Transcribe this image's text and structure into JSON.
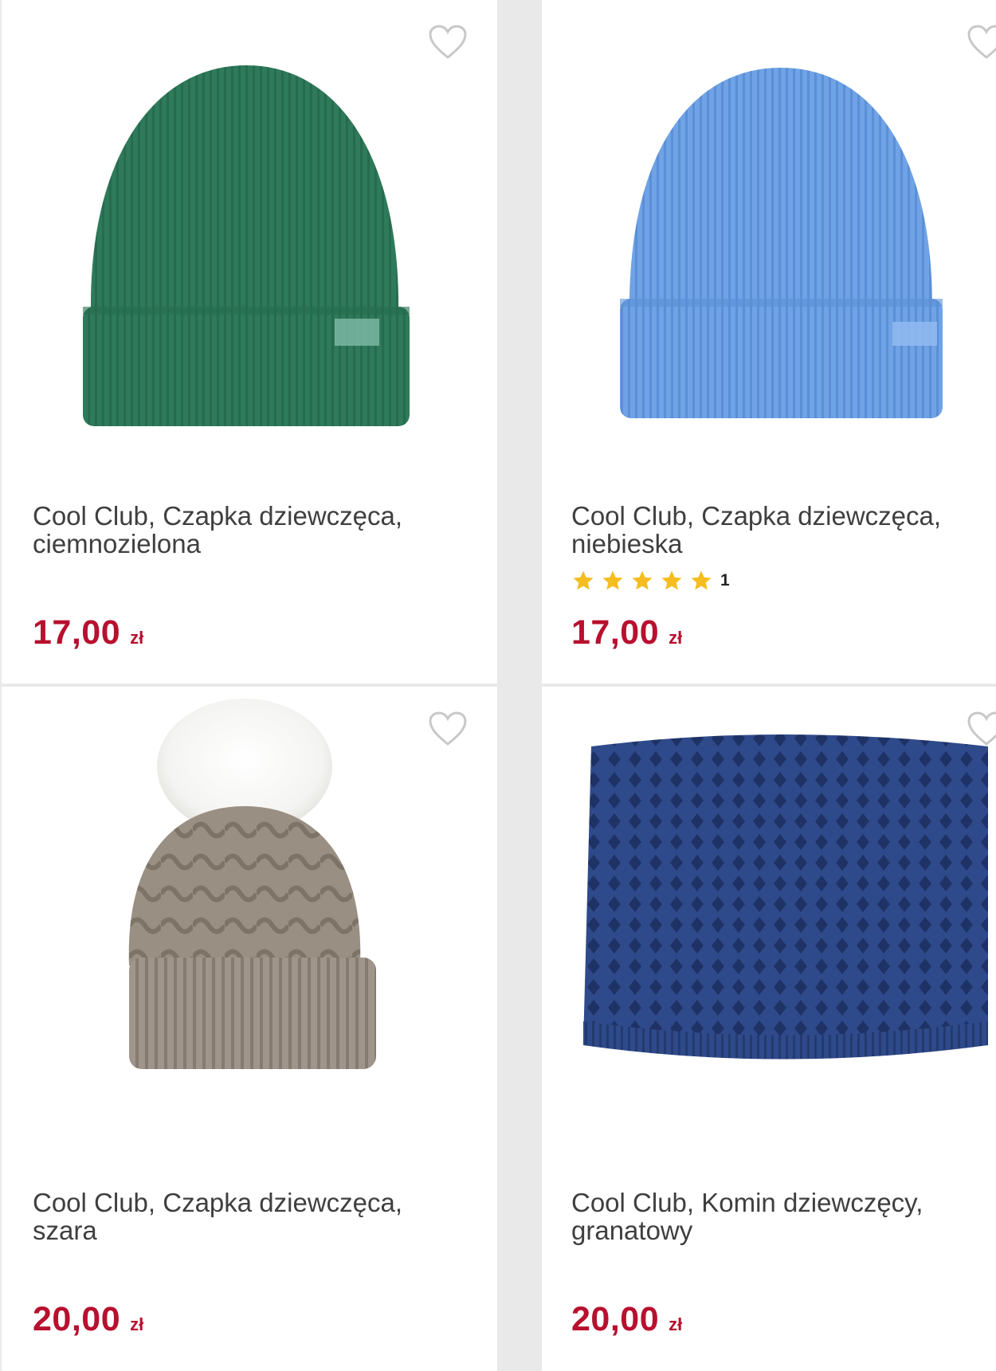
{
  "products": [
    {
      "title": "Cool Club, Czapka dziewczęca,\nciemnozielona",
      "price": "17,00",
      "currency": "zł",
      "rating_count": "",
      "color": "#2e7a5a",
      "image_icon": "green-beanie"
    },
    {
      "title": "Cool Club, Czapka dziewczęca,\nniebieska",
      "price": "17,00",
      "currency": "zł",
      "rating_stars": 5,
      "rating_count": "1",
      "color": "#6fa3e6",
      "image_icon": "blue-beanie"
    },
    {
      "title": "Cool Club, Czapka dziewczęca,\nszara",
      "price": "20,00",
      "currency": "zł",
      "rating_count": "",
      "color": "#9a8f83",
      "image_icon": "grey-pompom-hat"
    },
    {
      "title": "Cool Club, Komin dziewczęcy,\ngranatowy",
      "price": "20,00",
      "currency": "zł",
      "rating_count": "",
      "color": "#2f4a8a",
      "image_icon": "navy-snood"
    }
  ],
  "colors": {
    "price": "#b8102f",
    "star": "#f5bd1f",
    "heart_outline": "#c8c8c8"
  }
}
